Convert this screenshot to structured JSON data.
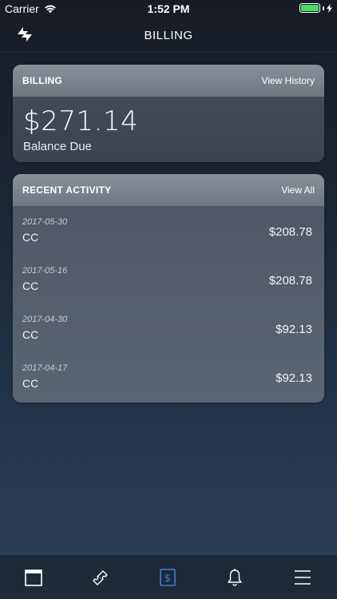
{
  "status_bar": {
    "carrier": "Carrier",
    "time": "1:52 PM",
    "battery_level": 1.0
  },
  "nav": {
    "title": "BILLING",
    "left_icon": "sync-icon"
  },
  "billing": {
    "header_title": "BILLING",
    "header_link": "View History",
    "balance": "$271.14",
    "balance_label": "Balance Due"
  },
  "activity": {
    "header_title": "RECENT ACTIVITY",
    "header_link": "View All",
    "items": [
      {
        "date": "2017-05-30",
        "method": "CC",
        "amount": "$208.78"
      },
      {
        "date": "2017-05-16",
        "method": "CC",
        "amount": "$208.78"
      },
      {
        "date": "2017-04-30",
        "method": "CC",
        "amount": "$92.13"
      },
      {
        "date": "2017-04-17",
        "method": "CC",
        "amount": "$92.13"
      }
    ]
  },
  "tab_bar": {
    "tabs": [
      {
        "icon": "calendar-icon",
        "active": false
      },
      {
        "icon": "ticket-icon",
        "active": false
      },
      {
        "icon": "billing-dollar-icon",
        "active": true
      },
      {
        "icon": "bell-icon",
        "active": false
      },
      {
        "icon": "menu-icon",
        "active": false
      }
    ],
    "active_color": "#3d7fd6",
    "inactive_color": "#ffffff"
  }
}
